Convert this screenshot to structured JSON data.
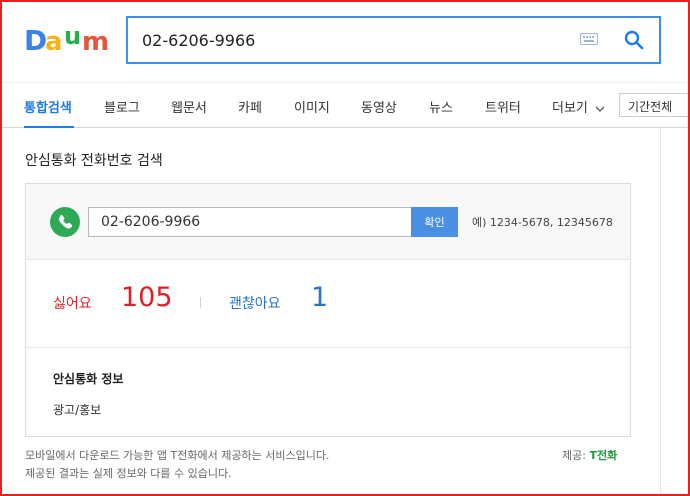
{
  "logo": {
    "text": "Daum",
    "colors": [
      "#3b82e6",
      "#f5b31a",
      "#23b14d",
      "#e8533f"
    ]
  },
  "search": {
    "query": "02-6206-9966",
    "keyboard_icon": "keyboard-icon",
    "search_icon": "search-icon"
  },
  "tabs": [
    {
      "label": "통합검색",
      "active": true
    },
    {
      "label": "블로그"
    },
    {
      "label": "웹문서"
    },
    {
      "label": "카페"
    },
    {
      "label": "이미지"
    },
    {
      "label": "동영상"
    },
    {
      "label": "뉴스"
    },
    {
      "label": "트위터"
    }
  ],
  "more_tab": "더보기",
  "period_filter": "기간전체",
  "section_title": "안심통화 전화번호 검색",
  "lookup": {
    "phone_value": "02-6206-9966",
    "confirm_label": "확인",
    "example": "예) 1234-5678, 12345678"
  },
  "stats": {
    "dislike_label": "싫어요",
    "dislike_count": "105",
    "like_label": "괜찮아요",
    "like_count": "1"
  },
  "info": {
    "title": "안심통화 정보",
    "value": "광고/홍보"
  },
  "footer": {
    "line1": "모바일에서 다운로드 가능한 앱 T전화에서 제공하는 서비스입니다.",
    "line2": "제공된 결과는 실제 정보와 다를 수 있습니다.",
    "provider_label": "제공: ",
    "provider_name": "T전화"
  },
  "colors": {
    "accent": "#1d7ce8",
    "dislike": "#e31e24",
    "like": "#2a74c8",
    "phone_green": "#2eaa56"
  }
}
